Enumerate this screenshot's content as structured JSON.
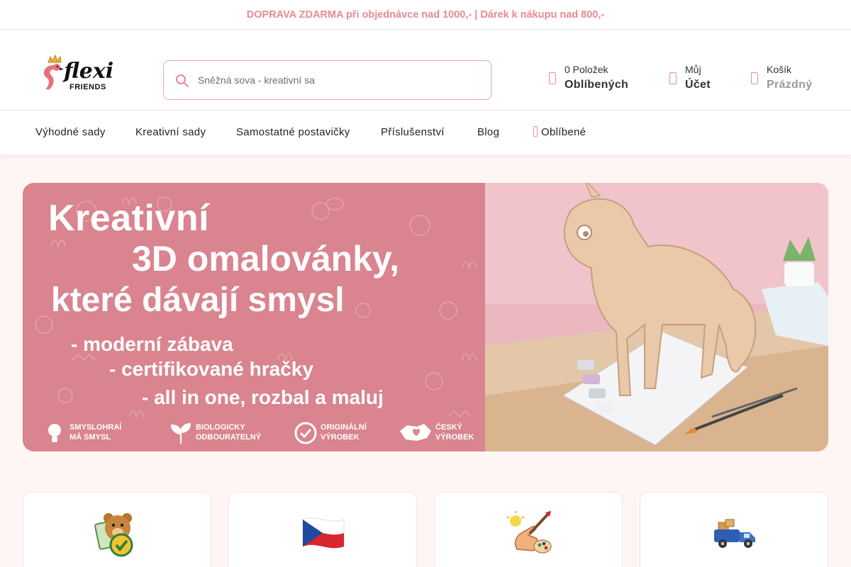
{
  "topbar": {
    "text": "DOPRAVA ZDARMA při objednávce nad 1000,- | Dárek k nákupu nad 800,-"
  },
  "header": {
    "logo": {
      "word": "flexi",
      "sub": "FRIENDS"
    },
    "search": {
      "placeholder": "Sněžná sova - kreativní sa"
    },
    "favorites": {
      "line1": "0 Položek",
      "line2": "Oblíbených",
      "icon": "heart-icon"
    },
    "account": {
      "line1": "Můj",
      "line2": "Účet",
      "icon": "user-icon"
    },
    "cart": {
      "line1": "Košík",
      "line2": "Prázdný",
      "icon": "cart-icon"
    }
  },
  "nav": {
    "items": [
      {
        "label": "Výhodné sady"
      },
      {
        "label": "Kreativní sady"
      },
      {
        "label": "Samostatné postavičky"
      },
      {
        "label": "Příslušenství"
      },
      {
        "label": "Blog"
      },
      {
        "label": "Oblíbené"
      }
    ]
  },
  "hero": {
    "title1": "Kreativní",
    "title2": "3D omalovánky,",
    "title3": "které dávají smysl",
    "bullet1": "- moderní zábava",
    "bullet2": "- certifikované hračky",
    "bullet3": "- all in one, rozbal a maluj",
    "badges": [
      {
        "line1": "SMYSLOHRAÍ",
        "line2": "MÁ SMYSL",
        "icon": "lightbulb-icon"
      },
      {
        "line1": "BIOLOGICKY",
        "line2": "ODBOURATELNÝ",
        "icon": "sprout-icon"
      },
      {
        "line1": "ORIGINÁLNÍ",
        "line2": "VÝROBEK",
        "icon": "check-badge-icon"
      },
      {
        "line1": "ČESKÝ",
        "line2": "VÝROBEK",
        "icon": "czech-map-icon"
      }
    ]
  },
  "colors": {
    "accent": "#e98a92",
    "hero_bg": "#d9848e",
    "page_bg": "#fdf6f4"
  },
  "feature_cards": [
    {
      "icon": "teddy-certified-icon"
    },
    {
      "icon": "czech-flag-icon"
    },
    {
      "icon": "creative-hand-icon"
    },
    {
      "icon": "delivery-truck-icon"
    }
  ]
}
